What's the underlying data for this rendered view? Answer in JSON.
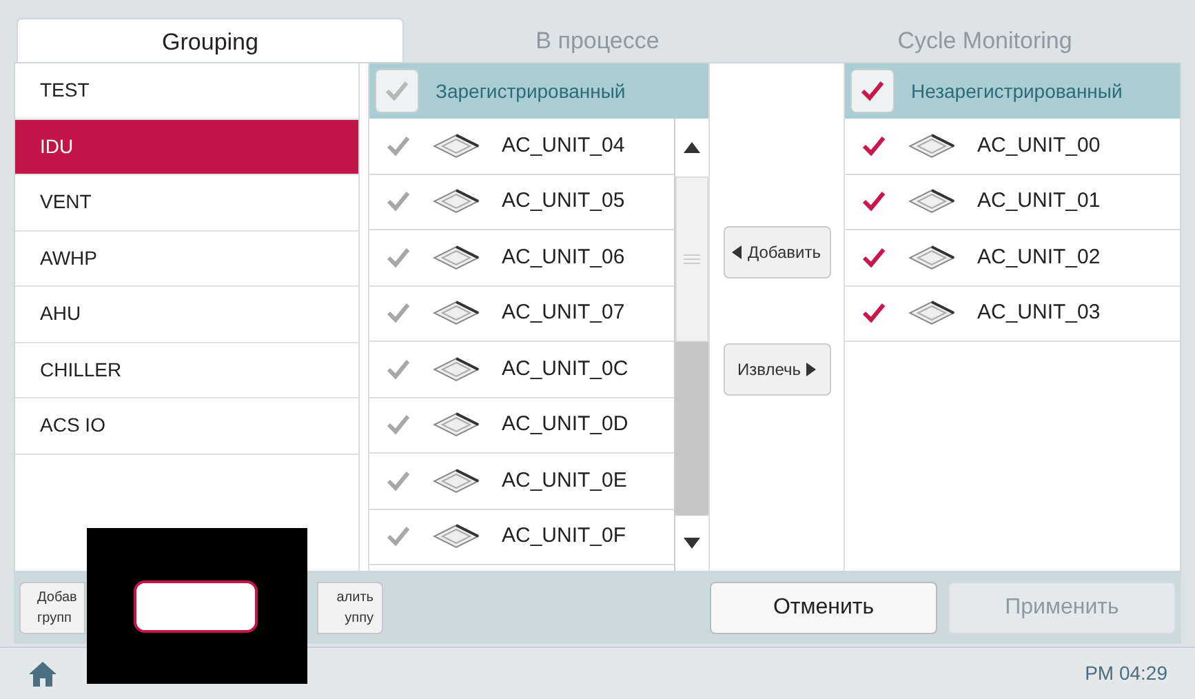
{
  "tabs": [
    {
      "label": "Grouping",
      "selected": true
    },
    {
      "label": "В процессе",
      "selected": false
    },
    {
      "label": "Cycle Monitoring",
      "selected": false
    }
  ],
  "groups": [
    {
      "label": "TEST",
      "selected": false
    },
    {
      "label": "IDU",
      "selected": true
    },
    {
      "label": "VENT",
      "selected": false
    },
    {
      "label": "AWHP",
      "selected": false
    },
    {
      "label": "AHU",
      "selected": false
    },
    {
      "label": "CHILLER",
      "selected": false
    },
    {
      "label": "ACS IO",
      "selected": false
    }
  ],
  "registered": {
    "header": "Зарегистрированный",
    "all_checked": false,
    "units": [
      {
        "name": "AC_UNIT_04",
        "checked": false
      },
      {
        "name": "AC_UNIT_05",
        "checked": false
      },
      {
        "name": "AC_UNIT_06",
        "checked": false
      },
      {
        "name": "AC_UNIT_07",
        "checked": false
      },
      {
        "name": "AC_UNIT_0C",
        "checked": false
      },
      {
        "name": "AC_UNIT_0D",
        "checked": false
      },
      {
        "name": "AC_UNIT_0E",
        "checked": false
      },
      {
        "name": "AC_UNIT_0F",
        "checked": false
      }
    ]
  },
  "transfer": {
    "add": "Добавить",
    "remove": "Извлечь"
  },
  "unregistered": {
    "header": "Незарегистрированный",
    "all_checked": true,
    "units": [
      {
        "name": "AC_UNIT_00",
        "checked": true
      },
      {
        "name": "AC_UNIT_01",
        "checked": true
      },
      {
        "name": "AC_UNIT_02",
        "checked": true
      },
      {
        "name": "AC_UNIT_03",
        "checked": true
      }
    ]
  },
  "group_buttons": [
    {
      "lines": [
        "Добав",
        "групп"
      ]
    },
    {
      "lines": [
        "алить",
        "уппу"
      ]
    }
  ],
  "actions": [
    {
      "label": "Отменить",
      "disabled": false
    },
    {
      "label": "Применить",
      "disabled": true
    }
  ],
  "status_bar": {
    "time": "PM 04:29"
  }
}
